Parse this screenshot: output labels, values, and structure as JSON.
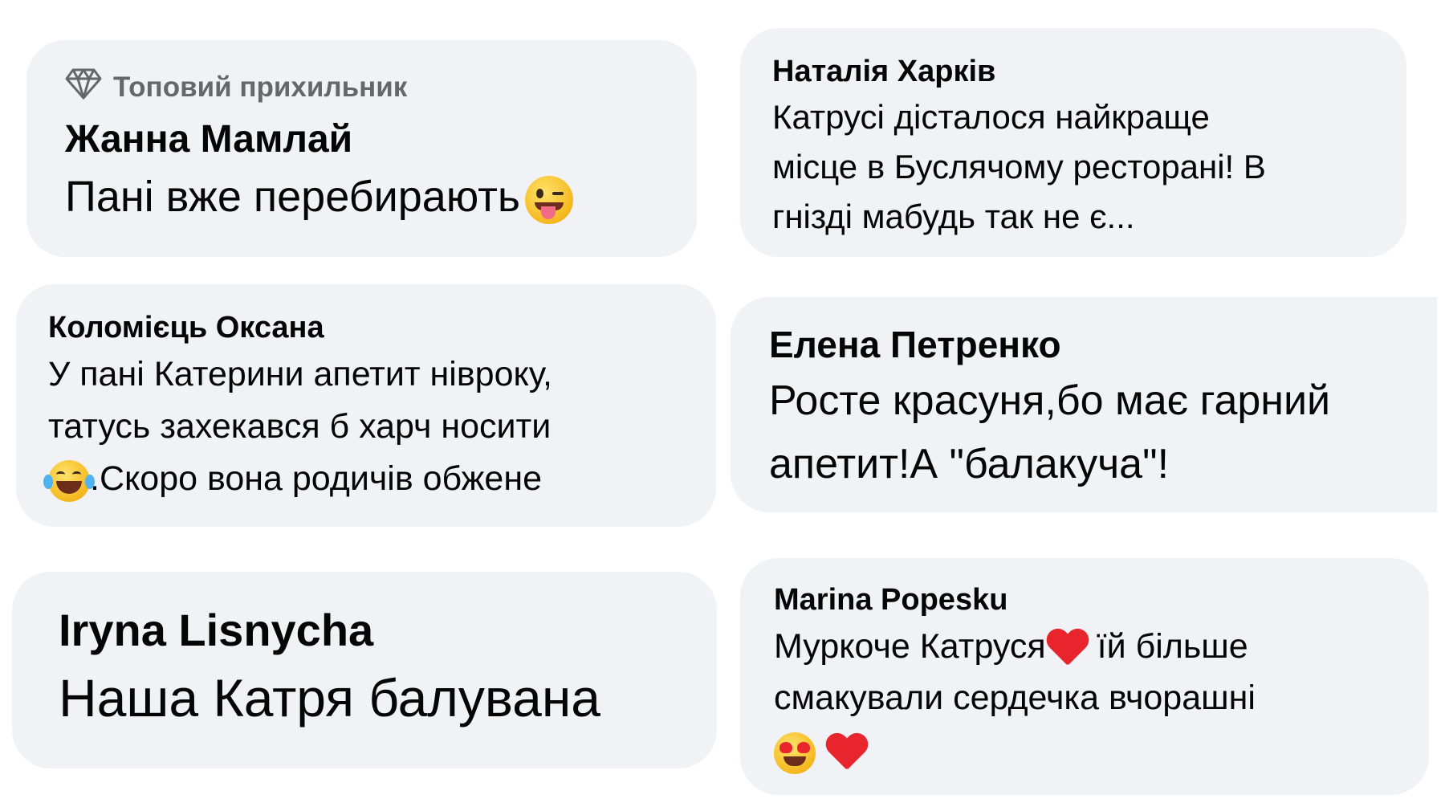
{
  "comments": [
    {
      "badge": "Топовий прихильник",
      "badge_icon": "diamond-icon",
      "author": "Жанна Мамлай",
      "text": "Пані вже перебирають",
      "emoji_after": "winking-tongue-face-emoji"
    },
    {
      "author": "Наталія Харків",
      "lines": [
        "Катрусі дісталося найкраще",
        "місце в Буслячому ресторані! В",
        "гнізді мабудь так не є..."
      ]
    },
    {
      "author": "Коломієць Оксана",
      "lines": [
        "У пані Катерини апетит нівроку,",
        "татусь захекався б харч носити",
        ".Скоро вона родичів обжене"
      ],
      "emoji_before_line3": "tears-of-joy-emoji"
    },
    {
      "author": "Елена Петренко",
      "lines": [
        "Росте красуня,бо має гарний",
        "апетит!А \"балакуча\"!"
      ]
    },
    {
      "author": "Iryna Lisnycha",
      "text": "Наша Катря балувана"
    },
    {
      "author": "Marina Popesku",
      "line1": "Муркоче Катруся",
      "line1b": " їй більше",
      "line2": "смакували сердечка вчорашні",
      "emojis": [
        "red-heart-emoji",
        "heart-eyes-emoji",
        "red-heart-emoji"
      ]
    }
  ],
  "colors": {
    "bubble_bg": "#f0f2f5",
    "text": "#050505",
    "badge_text": "#65676b",
    "heart": "#e8252d"
  }
}
